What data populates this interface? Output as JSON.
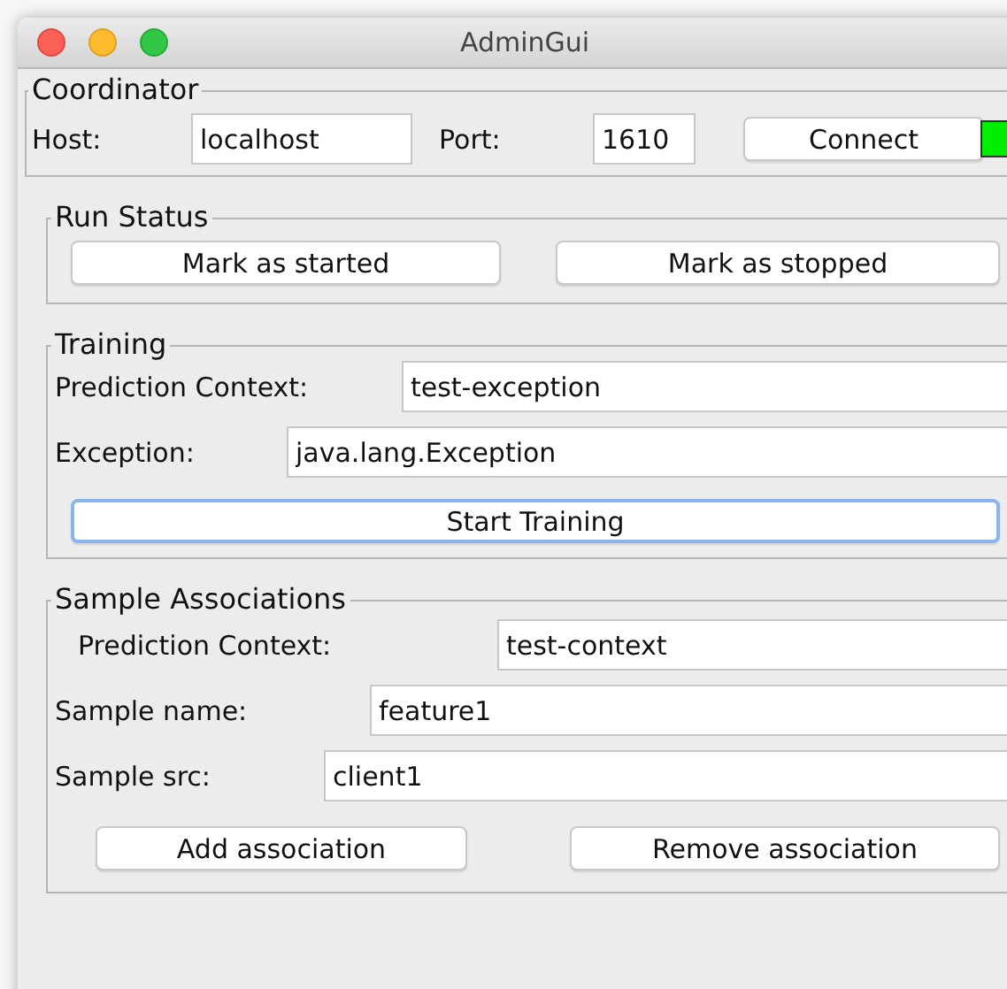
{
  "window": {
    "title": "AdminGui"
  },
  "coordinator": {
    "title": "Coordinator",
    "host_label": "Host:",
    "host": "localhost",
    "port_label": "Port:",
    "port": "1610",
    "connect_button": "Connect",
    "connected": true
  },
  "run_status": {
    "title": "Run Status",
    "buttons": [
      "Mark as started",
      "Mark as stopped"
    ]
  },
  "training": {
    "title": "Training",
    "fields": [
      {
        "label": "Prediction Context:",
        "value": "test-exception"
      },
      {
        "label": "Exception:",
        "value": "java.lang.Exception"
      }
    ],
    "button": {
      "label": "Start Training",
      "focused": true
    }
  },
  "sample_associations": {
    "title": "Sample Associations",
    "fields": [
      {
        "label": "Prediction Context:",
        "value": "test-context"
      },
      {
        "label": "Sample name:",
        "value": "feature1"
      },
      {
        "label": "Sample src:",
        "value": "client1"
      }
    ],
    "buttons": [
      "Add association",
      "Remove association"
    ]
  }
}
